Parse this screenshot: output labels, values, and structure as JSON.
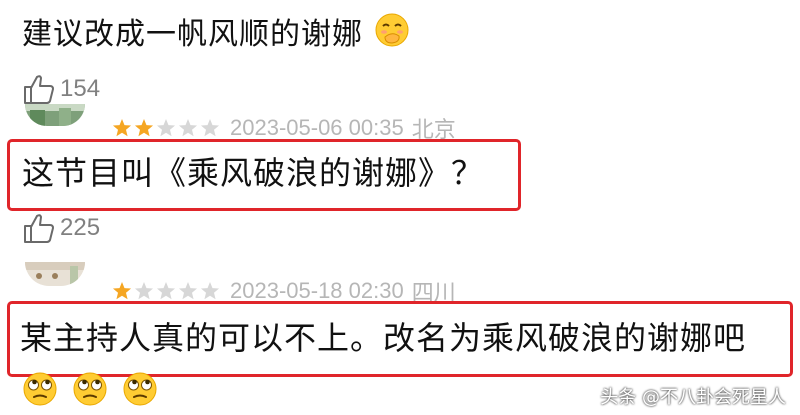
{
  "comment1": {
    "text": "建议改成一帆风顺的谢娜",
    "emoji": "hand-over-mouth-emoji"
  },
  "likes1": {
    "icon": "thumbs-up-icon",
    "count": "154"
  },
  "review1": {
    "rating": 2,
    "max_rating": 5,
    "date": "2023-05-06 00:35",
    "location": "北京",
    "text": "这节目叫《乘风破浪的谢娜》？"
  },
  "likes2": {
    "icon": "thumbs-up-icon",
    "count": "225"
  },
  "review2": {
    "rating": 1,
    "max_rating": 5,
    "date": "2023-05-18 02:30",
    "location": "四川",
    "text": "某主持人真的可以不上。改名为乘风破浪的谢娜吧",
    "emojis": [
      "eye-roll-emoji",
      "eye-roll-emoji",
      "eye-roll-emoji"
    ]
  },
  "watermark": "头条 @不八卦会死星人",
  "colors": {
    "highlight_border": "#e0252a",
    "star_filled": "#f5a623",
    "star_empty": "#d7d7d7",
    "meta_text": "#b6b6b6"
  }
}
